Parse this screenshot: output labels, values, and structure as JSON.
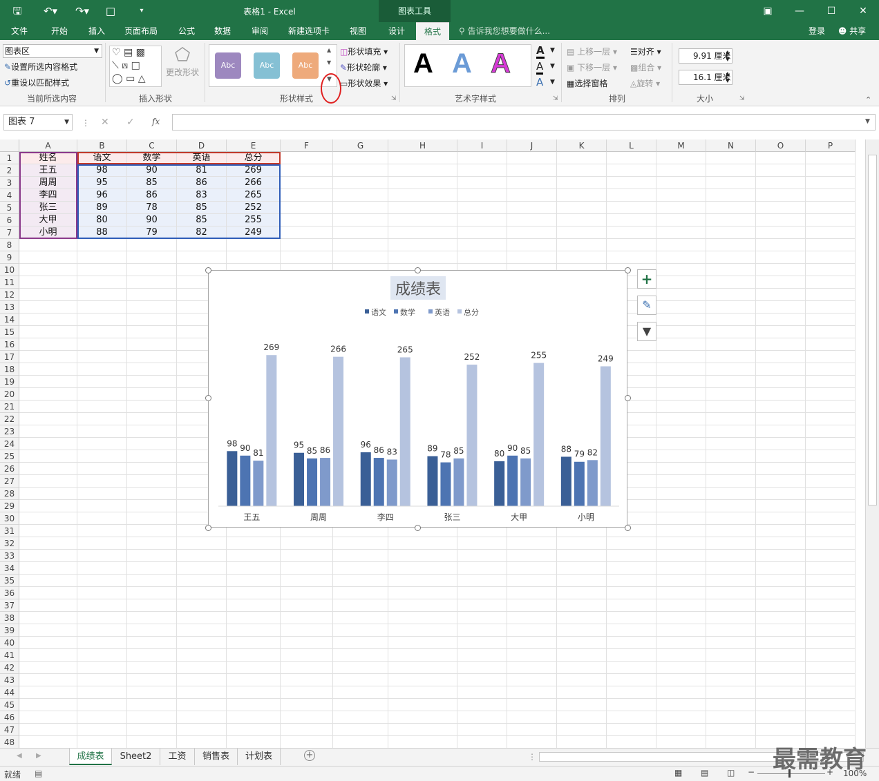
{
  "titlebar": {
    "doc_title": "表格1 - Excel",
    "context_tools": "图表工具"
  },
  "tabs": [
    "文件",
    "开始",
    "插入",
    "页面布局",
    "公式",
    "数据",
    "审阅",
    "新建选项卡",
    "视图",
    "设计",
    "格式"
  ],
  "tell_me": "告诉我您想要做什么...",
  "account": {
    "login": "登录",
    "share": "共享"
  },
  "ribbon": {
    "current_selection": {
      "dropdown": "图表区",
      "format_btn": "设置所选内容格式",
      "reset_btn": "重设以匹配样式",
      "label": "当前所选内容"
    },
    "insert_shapes": {
      "change_shape": "更改形状",
      "label": "插入形状"
    },
    "shape_styles": {
      "sample": "Abc",
      "fill": "形状填充",
      "outline": "形状轮廓",
      "effect": "形状效果",
      "label": "形状样式"
    },
    "wordart": {
      "sample": "A",
      "label": "艺术字样式"
    },
    "arrange": {
      "bring_forward": "上移一层",
      "send_backward": "下移一层",
      "selection_pane": "选择窗格",
      "align": "对齐",
      "group": "组合",
      "rotate": "旋转",
      "label": "排列"
    },
    "size": {
      "height": "9.91 厘米",
      "width": "16.1 厘米",
      "label": "大小"
    }
  },
  "formula": {
    "namebox": "图表 7",
    "fx": "fx",
    "value": ""
  },
  "columns": [
    "A",
    "B",
    "C",
    "D",
    "E",
    "F",
    "G",
    "H",
    "I",
    "J",
    "K",
    "L",
    "M",
    "N",
    "O",
    "P"
  ],
  "table": {
    "headers": [
      "姓名",
      "语文",
      "数学",
      "英语",
      "总分"
    ],
    "rows": [
      [
        "王五",
        "98",
        "90",
        "81",
        "269"
      ],
      [
        "周周",
        "95",
        "85",
        "86",
        "266"
      ],
      [
        "李四",
        "96",
        "86",
        "83",
        "265"
      ],
      [
        "张三",
        "89",
        "78",
        "85",
        "252"
      ],
      [
        "大甲",
        "80",
        "90",
        "85",
        "255"
      ],
      [
        "小明",
        "88",
        "79",
        "82",
        "249"
      ]
    ]
  },
  "chart_data": {
    "type": "bar",
    "title": "成绩表",
    "categories": [
      "王五",
      "周周",
      "李四",
      "张三",
      "大甲",
      "小明"
    ],
    "series": [
      {
        "name": "语文",
        "values": [
          98,
          95,
          96,
          89,
          80,
          88
        ],
        "color": "#3a5f96"
      },
      {
        "name": "数学",
        "values": [
          90,
          85,
          86,
          78,
          90,
          79
        ],
        "color": "#4d74b2"
      },
      {
        "name": "英语",
        "values": [
          81,
          86,
          83,
          85,
          85,
          82
        ],
        "color": "#7f9acb"
      },
      {
        "name": "总分",
        "values": [
          269,
          266,
          265,
          252,
          255,
          249
        ],
        "color": "#b5c3df"
      }
    ],
    "ylim": [
      0,
      300
    ],
    "legend": "top",
    "grid": false,
    "data_labels": true
  },
  "sheets": [
    "成绩表",
    "Sheet2",
    "工资",
    "销售表",
    "计划表"
  ],
  "status": {
    "ready": "就绪",
    "zoom": "100%"
  },
  "watermark": "最需教育"
}
